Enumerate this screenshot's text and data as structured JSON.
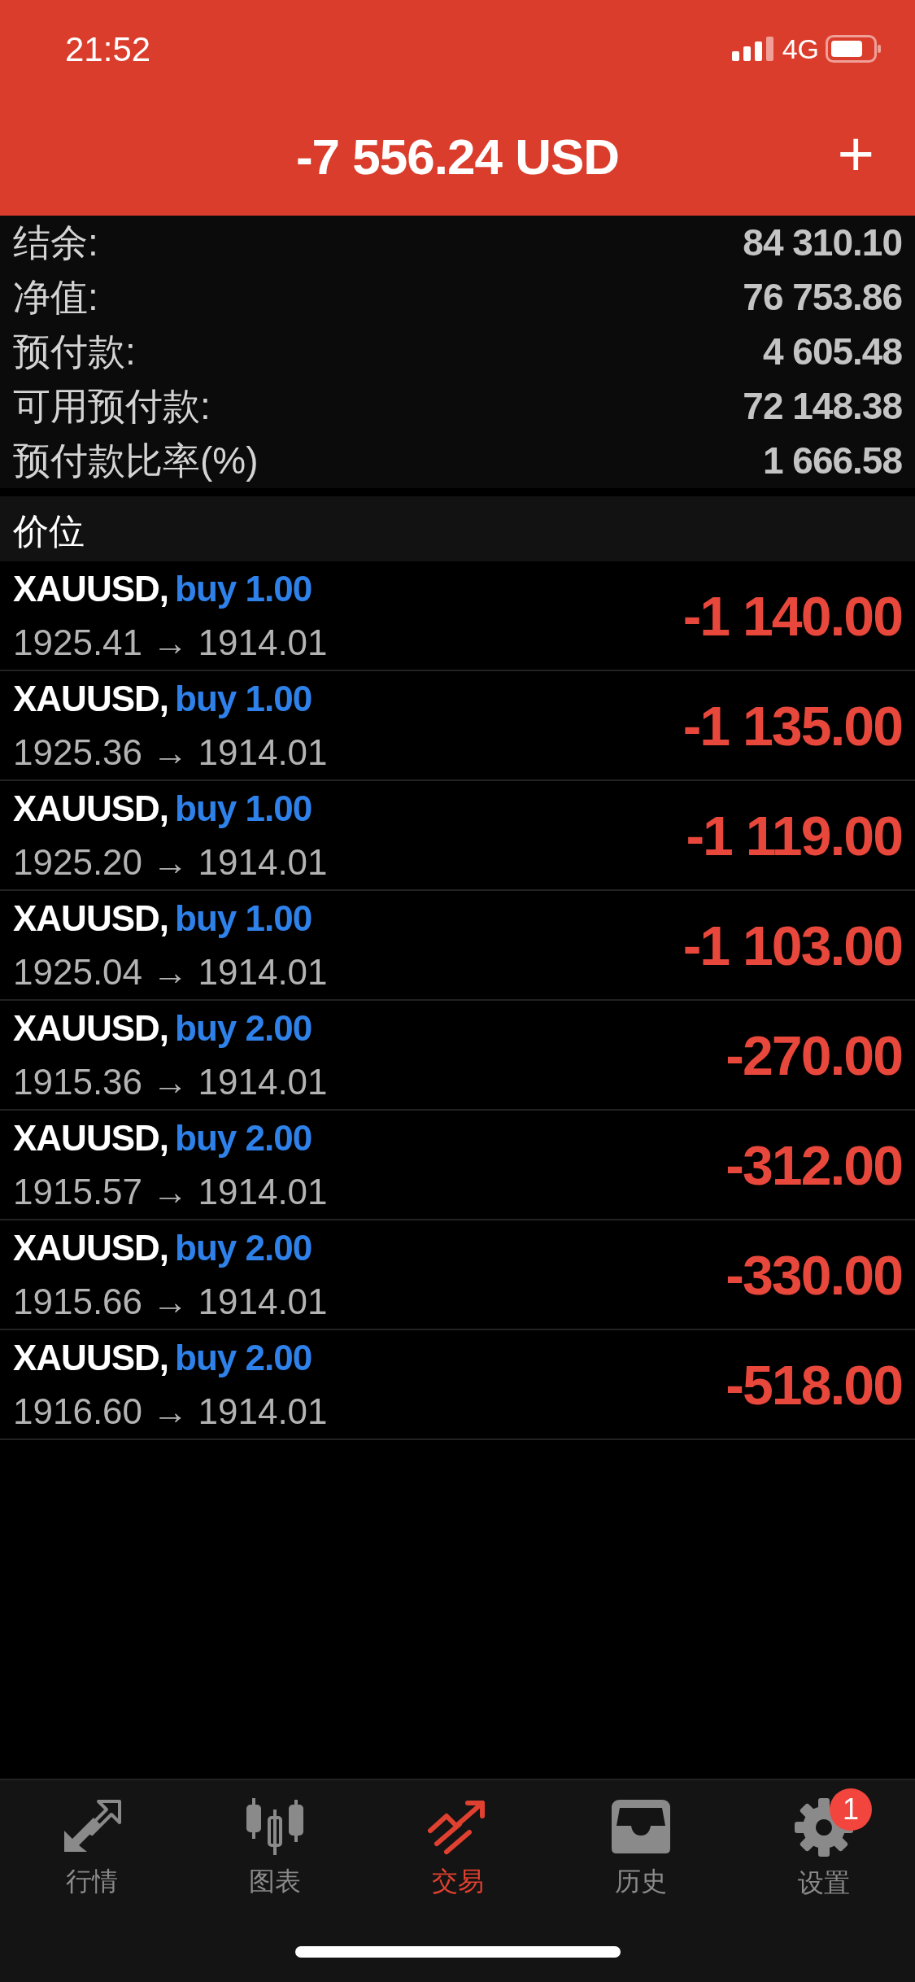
{
  "status_bar": {
    "time": "21:52",
    "network": "4G"
  },
  "header": {
    "title": "-7 556.24 USD",
    "add_button": "+"
  },
  "summary": [
    {
      "label": "结余:",
      "value": "84 310.10"
    },
    {
      "label": "净值:",
      "value": "76 753.86"
    },
    {
      "label": "预付款:",
      "value": "4 605.48"
    },
    {
      "label": "可用预付款:",
      "value": "72 148.38"
    },
    {
      "label": "预付款比率(%)",
      "value": "1 666.58"
    }
  ],
  "section_title": "价位",
  "positions": [
    {
      "symbol": "XAUUSD,",
      "order": "buy 1.00",
      "prices": "1925.41 → 1914.01",
      "profit": "-1 140.00"
    },
    {
      "symbol": "XAUUSD,",
      "order": "buy 1.00",
      "prices": "1925.36 → 1914.01",
      "profit": "-1 135.00"
    },
    {
      "symbol": "XAUUSD,",
      "order": "buy 1.00",
      "prices": "1925.20 → 1914.01",
      "profit": "-1 119.00"
    },
    {
      "symbol": "XAUUSD,",
      "order": "buy 1.00",
      "prices": "1925.04 → 1914.01",
      "profit": "-1 103.00"
    },
    {
      "symbol": "XAUUSD,",
      "order": "buy 2.00",
      "prices": "1915.36 → 1914.01",
      "profit": "-270.00"
    },
    {
      "symbol": "XAUUSD,",
      "order": "buy 2.00",
      "prices": "1915.57 → 1914.01",
      "profit": "-312.00"
    },
    {
      "symbol": "XAUUSD,",
      "order": "buy 2.00",
      "prices": "1915.66 → 1914.01",
      "profit": "-330.00"
    },
    {
      "symbol": "XAUUSD,",
      "order": "buy 2.00",
      "prices": "1916.60 → 1914.01",
      "profit": "-518.00"
    }
  ],
  "tab_bar": [
    {
      "kind": "quotes",
      "label": "行情",
      "selected": false
    },
    {
      "kind": "chart",
      "label": "图表",
      "selected": false
    },
    {
      "kind": "trade",
      "label": "交易",
      "selected": true
    },
    {
      "kind": "history",
      "label": "历史",
      "selected": false
    },
    {
      "kind": "settings",
      "label": "设置",
      "selected": false,
      "badge": "1"
    }
  ]
}
